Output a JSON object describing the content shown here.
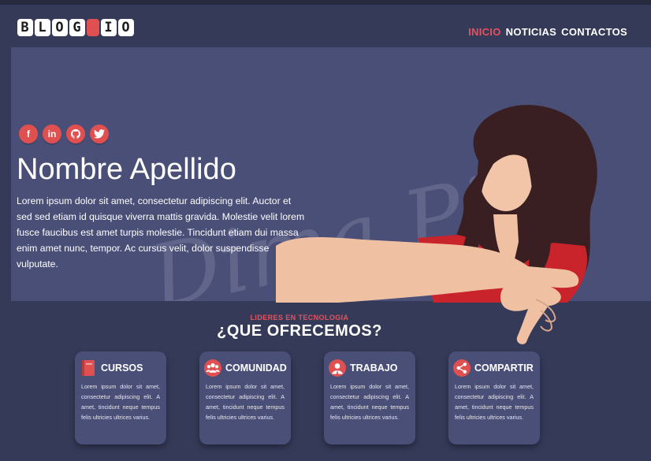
{
  "header": {
    "logo_letters": [
      "B",
      "L",
      "O",
      "G",
      "",
      "I",
      "O"
    ],
    "nav": [
      {
        "label": "INICIO",
        "active": true
      },
      {
        "label": "NOTICIAS",
        "active": false
      },
      {
        "label": "CONTACTOS",
        "active": false
      }
    ]
  },
  "hero": {
    "social": [
      "f",
      "in",
      "gh",
      "tw"
    ],
    "watermark": "Dima Pie",
    "title": "Nombre Apellido",
    "text": "Lorem ipsum dolor sit amet, consectetur adipiscing elit. Auctor et sed sed etiam id quisque viverra mattis gravida. Molestie velit lorem fusce faucibus est amet turpis molestie. Tincidunt etiam dui massa enim amet nunc, tempor. Ac cursus velit, dolor suspendisse vulputate.",
    "slides_total": 5,
    "slide_active": 1
  },
  "section": {
    "kicker": "LIDERES EN TECNOLOGIA",
    "title": "¿QUE OFRECEMOS?"
  },
  "cards": [
    {
      "title": "CURSOS",
      "icon": "book-icon",
      "text": "Lorem ipsum dolor sit amet, consectetur adipiscing elit. A amet, tincidunt neque tempus felis ultricies ultrices varius."
    },
    {
      "title": "COMUNIDAD",
      "icon": "community-icon",
      "text": "Lorem ipsum dolor sit amet, consectetur adipiscing elit. A amet, tincidunt neque tempus felis ultricies ultrices varius."
    },
    {
      "title": "TRABAJO",
      "icon": "worker-icon",
      "text": "Lorem ipsum dolor sit amet, consectetur adipiscing elit. A amet, tincidunt neque tempus felis ultricies ultrices varius."
    },
    {
      "title": "COMPARTIR",
      "icon": "share-icon",
      "text": "Lorem ipsum dolor sit amet, consectetur adipiscing elit. A amet, tincidunt neque tempus felis ultricies ultrices varius."
    }
  ],
  "colors": {
    "accent": "#e9505b",
    "background": "#353a58",
    "hero": "#4a4f78"
  }
}
